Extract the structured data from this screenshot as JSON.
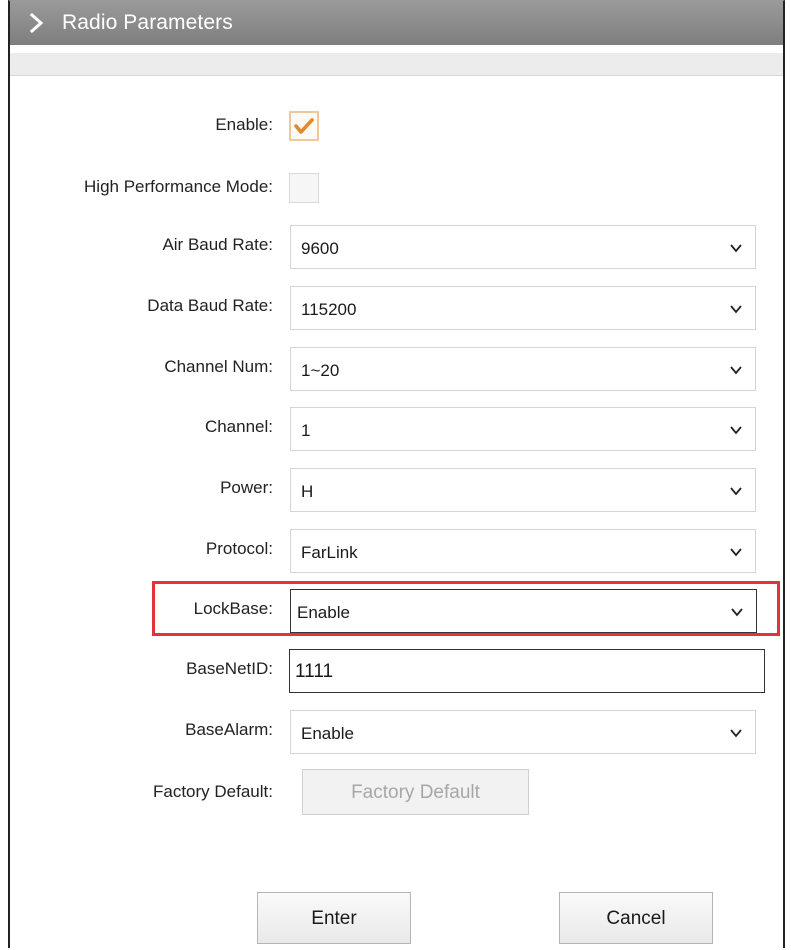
{
  "header": {
    "title": "Radio Parameters",
    "icon": "chevron-right-icon"
  },
  "form": {
    "enable": {
      "label": "Enable:",
      "checked": true
    },
    "high_performance_mode": {
      "label": "High Performance Mode:",
      "checked": false
    },
    "air_baud_rate": {
      "label": "Air Baud Rate:",
      "value": "9600"
    },
    "data_baud_rate": {
      "label": "Data Baud Rate:",
      "value": "115200"
    },
    "channel_num": {
      "label": "Channel Num:",
      "value": "1~20"
    },
    "channel": {
      "label": "Channel:",
      "value": "1"
    },
    "power": {
      "label": "Power:",
      "value": "H"
    },
    "protocol": {
      "label": "Protocol:",
      "value": "FarLink"
    },
    "lockbase": {
      "label": "LockBase:",
      "value": "Enable"
    },
    "basenetid": {
      "label": "BaseNetID:",
      "value": "1111"
    },
    "basealarm": {
      "label": "BaseAlarm:",
      "value": "Enable"
    },
    "factory_default": {
      "label": "Factory Default:",
      "button_label": "Factory Default"
    }
  },
  "actions": {
    "enter_label": "Enter",
    "cancel_label": "Cancel"
  },
  "colors": {
    "accent_orange": "#e08a2b",
    "highlight_red": "#e3333a",
    "titlebar_gray": "#8a8a8a"
  }
}
